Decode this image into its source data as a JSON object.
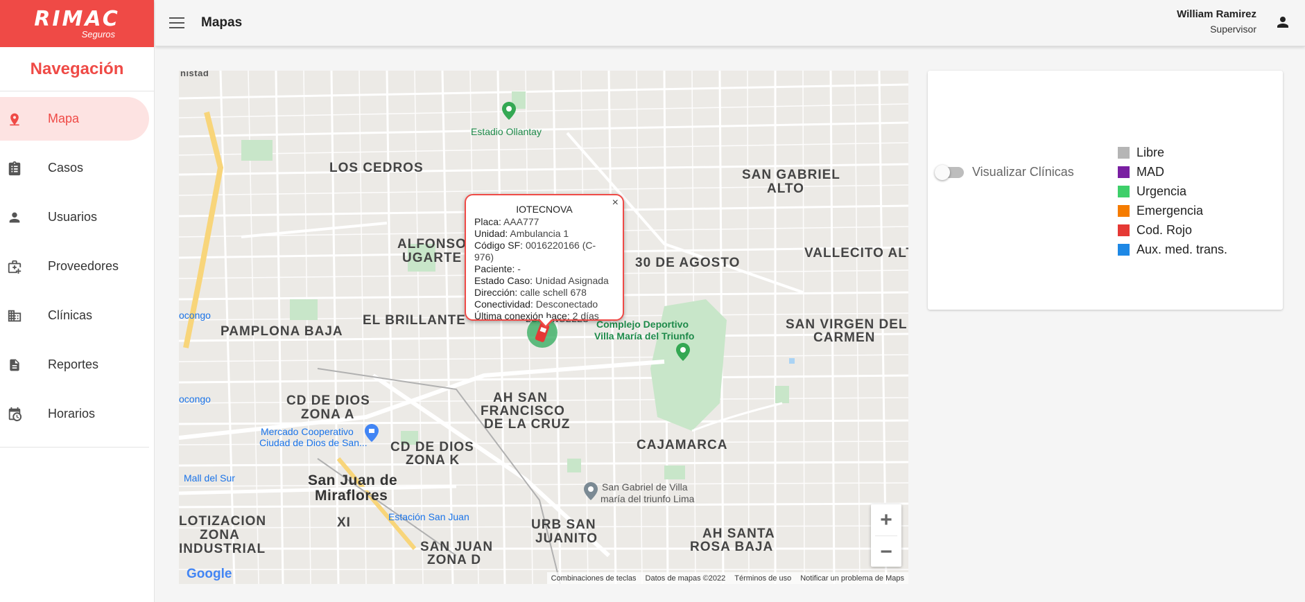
{
  "logo": {
    "brand": "RIMAC",
    "sub": "Seguros"
  },
  "sidebar": {
    "title": "Navegación",
    "items": [
      {
        "label": "Mapa",
        "icon": "location-pin-icon",
        "active": true
      },
      {
        "label": "Casos",
        "icon": "clipboard-icon"
      },
      {
        "label": "Usuarios",
        "icon": "person-icon"
      },
      {
        "label": "Proveedores",
        "icon": "medical-bag-icon"
      },
      {
        "label": "Clínicas",
        "icon": "building-icon"
      },
      {
        "label": "Reportes",
        "icon": "document-icon"
      },
      {
        "label": "Horarios",
        "icon": "calendar-clock-icon"
      }
    ]
  },
  "header": {
    "title": "Mapas",
    "user_name": "William Ramirez",
    "user_role": "Supervisor"
  },
  "map": {
    "popup": {
      "title": "IOTECNOVA",
      "rows": [
        {
          "key": "Placa:",
          "value": "AAA777"
        },
        {
          "key": "Unidad:",
          "value": "Ambulancia 1"
        },
        {
          "key": "Código SF:",
          "value": "0016220166 (C-976)"
        },
        {
          "key": "Paciente:",
          "value": "-"
        },
        {
          "key": "Estado Caso:",
          "value": "Unidad Asignada"
        },
        {
          "key": "Dirección:",
          "value": "calle schell 678"
        },
        {
          "key": "Conectividad:",
          "value": "Desconectado"
        },
        {
          "key": "Última conexión hace:",
          "value": "2 días"
        }
      ],
      "close": "×"
    },
    "labels": {
      "los_cedros": "LOS CEDROS",
      "san_gabriel_alto_1": "SAN GABRIEL",
      "san_gabriel_alto_2": "ALTO",
      "vallecito": "VALLECITO ALT",
      "alfonso_1": "ALFONSO",
      "alfonso_2": "UGARTE",
      "treinta_agosto": "30 DE AGOSTO",
      "el_brillante": "EL BRILLANTE",
      "pamplona_baja": "PAMPLONA BAJA",
      "virgen_1": "SAN VIRGEN DEL",
      "virgen_2": "CARMEN",
      "cd_dios_a_1": "CD DE DIOS",
      "cd_dios_a_2": "ZONA A",
      "cd_dios_k_1": "CD DE DIOS",
      "cd_dios_k_2": "ZONA K",
      "ah_san_francisco_1": "AH SAN",
      "ah_san_francisco_2": "FRANCISCO",
      "ah_san_francisco_3": "DE LA CRUZ",
      "cajamarca": "CAJAMARCA",
      "sjm_1": "San Juan de",
      "sjm_2": "Miraflores",
      "urb_san_juanito_1": "URB SAN",
      "urb_san_juanito_2": "JUANITO",
      "san_juan_d_1": "SAN JUAN",
      "san_juan_d_2": "ZONA D",
      "ah_santa_rosa_1": "AH SANTA",
      "ah_santa_rosa_2": "ROSA BAJA",
      "lotizacion_1": "LOTIZACION",
      "lotizacion_2": "ZONA",
      "lotizacion_3": "INDUSTRIAL",
      "estadio": "Estadio Ollantay",
      "complejo_1": "Complejo Deportivo",
      "complejo_2": "Villa María del Triunfo",
      "mercado_1": "Mercado Cooperativo",
      "mercado_2": "Ciudad de Dios de San...",
      "mall": "Mall del Sur",
      "estacion": "Estación San Juan",
      "san_gabriel_villa_1": "San Gabriel de Villa",
      "san_gabriel_villa_2": "maría del triunfo Lima",
      "ocongo_1": "ocongo",
      "ocongo_2": "ocongo",
      "nistad": "nistad",
      "los_angeles": "LOS ANGELES",
      "xi": "XI"
    },
    "google": "Google",
    "attribution": [
      "Combinaciones de teclas",
      "Datos de mapas ©2022",
      "Términos de uso",
      "Notificar un problema de Maps"
    ],
    "zoom_in": "+",
    "zoom_out": "−"
  },
  "panel": {
    "toggle_label": "Visualizar Clínicas",
    "legend": [
      {
        "label": "Libre",
        "color": "#b5b5b5"
      },
      {
        "label": "MAD",
        "color": "#7a1fa2"
      },
      {
        "label": "Urgencia",
        "color": "#3ecf6a"
      },
      {
        "label": "Emergencia",
        "color": "#f57c00"
      },
      {
        "label": "Cod. Rojo",
        "color": "#e53935"
      },
      {
        "label": "Aux. med. trans.",
        "color": "#1e88e5"
      }
    ]
  }
}
